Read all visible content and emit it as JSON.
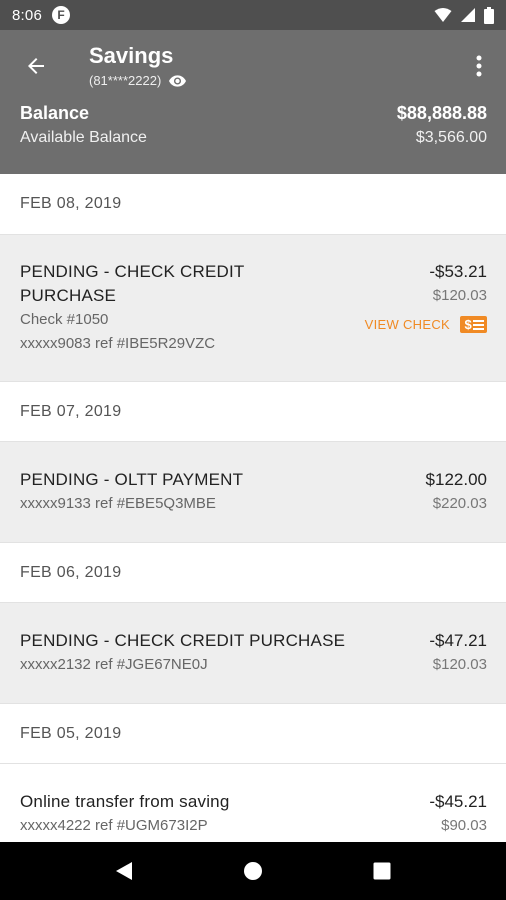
{
  "status_bar": {
    "time": "8:06",
    "app_badge": "F"
  },
  "header": {
    "title": "Savings",
    "account_number": "(81****2222)",
    "balance_label": "Balance",
    "balance_value": "$88,888.88",
    "available_label": "Available Balance",
    "available_value": "$3,566.00"
  },
  "groups": [
    {
      "date": "FEB 08, 2019",
      "transactions": [
        {
          "status": "pending",
          "description_line1": "PENDING - CHECK CREDIT",
          "description_line2": "PURCHASE",
          "check_number": "Check #1050",
          "reference": "xxxxx9083 ref #IBE5R29VZC",
          "amount": "-$53.21",
          "running_balance": "$120.03",
          "view_check_label": "VIEW CHECK"
        }
      ]
    },
    {
      "date": "FEB 07, 2019",
      "transactions": [
        {
          "status": "pending",
          "description": "PENDING - OLTT PAYMENT",
          "reference": "xxxxx9133 ref #EBE5Q3MBE",
          "amount": "$122.00",
          "running_balance": "$220.03"
        }
      ]
    },
    {
      "date": "FEB 06, 2019",
      "transactions": [
        {
          "status": "pending",
          "description": "PENDING - CHECK CREDIT PURCHASE",
          "reference": "xxxxx2132 ref #JGE67NE0J",
          "amount": "-$47.21",
          "running_balance": "$120.03"
        }
      ]
    },
    {
      "date": "FEB 05, 2019",
      "transactions": [
        {
          "status": "posted",
          "description": "Online transfer from saving",
          "reference": "xxxxx4222 ref #UGM673I2P",
          "amount": "-$45.21",
          "running_balance": "$90.03"
        }
      ]
    }
  ],
  "icons": {
    "back": "arrow-left-icon",
    "more": "more-vertical-icon",
    "eye": "eye-icon",
    "check": "check-document-icon"
  },
  "colors": {
    "status_bar": "#4f4f4f",
    "header": "#6e6e6e",
    "pending_row": "#eeeeee",
    "accent": "#f08a24",
    "nav_bar": "#000000"
  }
}
